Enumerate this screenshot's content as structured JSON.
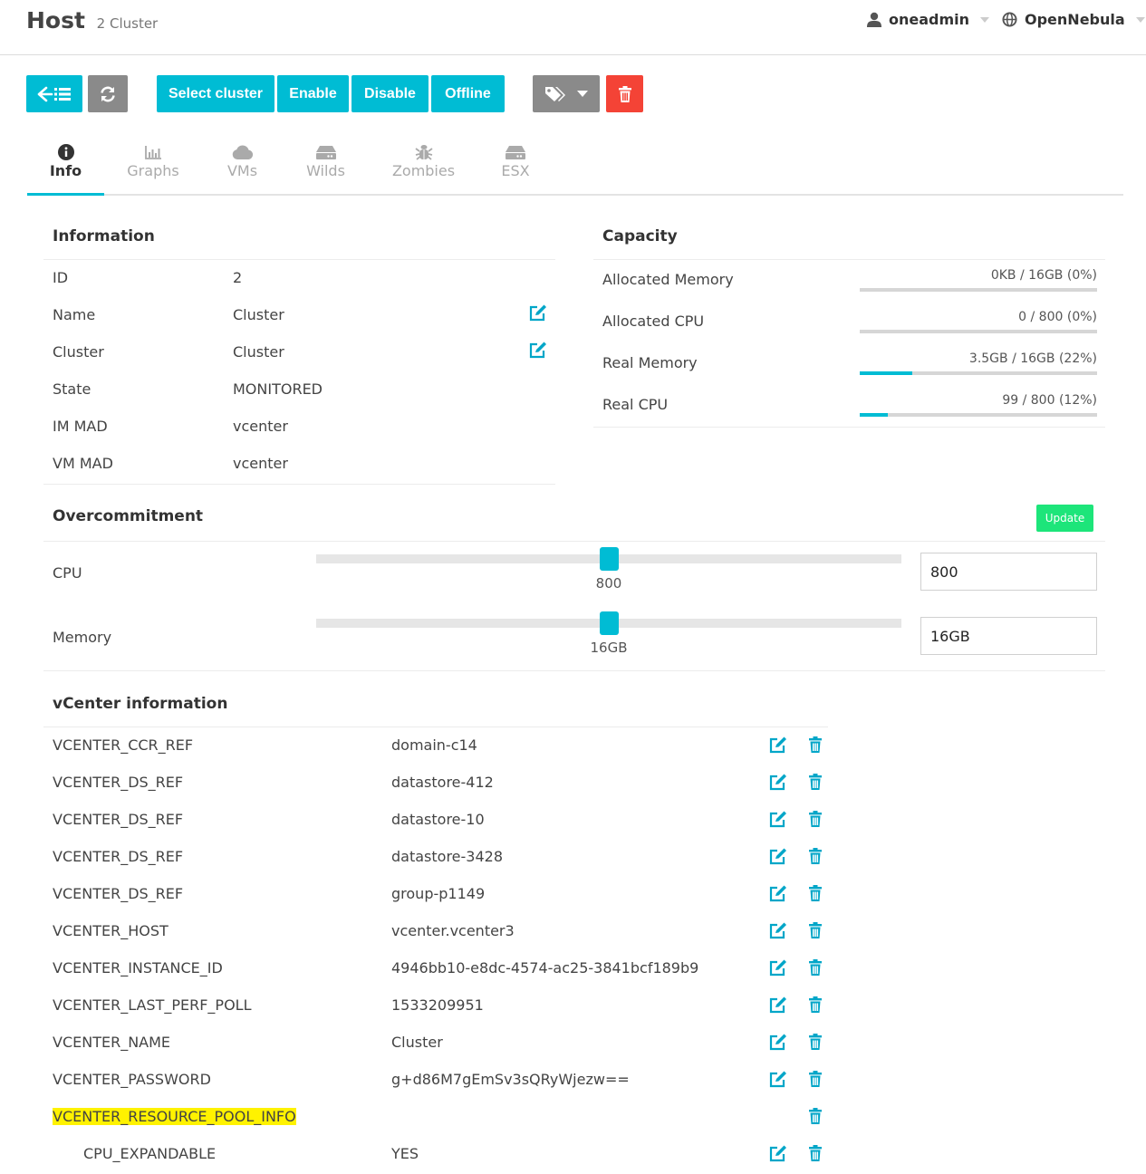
{
  "header": {
    "title": "Host",
    "id": "2",
    "name": "Cluster",
    "user": "oneadmin",
    "zone": "OpenNebula"
  },
  "toolbar": {
    "select_cluster": "Select cluster",
    "enable": "Enable",
    "disable": "Disable",
    "offline": "Offline"
  },
  "tabs": [
    "Info",
    "Graphs",
    "VMs",
    "Wilds",
    "Zombies",
    "ESX"
  ],
  "information": {
    "title": "Information",
    "rows": [
      {
        "label": "ID",
        "value": "2"
      },
      {
        "label": "Name",
        "value": "Cluster"
      },
      {
        "label": "Cluster",
        "value": "Cluster"
      },
      {
        "label": "State",
        "value": "MONITORED"
      },
      {
        "label": "IM MAD",
        "value": "vcenter"
      },
      {
        "label": "VM MAD",
        "value": "vcenter"
      }
    ]
  },
  "capacity": {
    "title": "Capacity",
    "rows": [
      {
        "label": "Allocated Memory",
        "value": "0KB / 16GB (0%)",
        "percent": 0
      },
      {
        "label": "Allocated CPU",
        "value": "0 / 800 (0%)",
        "percent": 0
      },
      {
        "label": "Real Memory",
        "value": "3.5GB / 16GB (22%)",
        "percent": 22
      },
      {
        "label": "Real CPU",
        "value": "99 / 800 (12%)",
        "percent": 12
      }
    ]
  },
  "overcommitment": {
    "title": "Overcommitment",
    "update": "Update",
    "cpu": {
      "label": "CPU",
      "value": "800",
      "slider_fraction": 0.5
    },
    "memory": {
      "label": "Memory",
      "value": "16GB",
      "slider_fraction": 0.5
    }
  },
  "vcenter": {
    "title": "vCenter information",
    "rows": [
      {
        "key": "VCENTER_CCR_REF",
        "value": "domain-c14"
      },
      {
        "key": "VCENTER_DS_REF",
        "value": "datastore-412"
      },
      {
        "key": "VCENTER_DS_REF",
        "value": "datastore-10"
      },
      {
        "key": "VCENTER_DS_REF",
        "value": "datastore-3428"
      },
      {
        "key": "VCENTER_DS_REF",
        "value": "group-p1149"
      },
      {
        "key": "VCENTER_HOST",
        "value": "vcenter.vcenter3"
      },
      {
        "key": "VCENTER_INSTANCE_ID",
        "value": "4946bb10-e8dc-4574-ac25-3841bcf189b9"
      },
      {
        "key": "VCENTER_LAST_PERF_POLL",
        "value": "1533209951"
      },
      {
        "key": "VCENTER_NAME",
        "value": "Cluster"
      },
      {
        "key": "VCENTER_PASSWORD",
        "value": "g+d86M7gEmSv3sQRyWjezw=="
      },
      {
        "key": "VCENTER_RESOURCE_POOL_INFO",
        "value": ""
      },
      {
        "key": "CPU_EXPANDABLE",
        "value": "YES"
      }
    ]
  },
  "colors": {
    "accent": "#00bcd4",
    "danger": "#f44336",
    "neutral": "#8a8a8a",
    "success": "#1de57a",
    "highlight": "#fff200"
  }
}
